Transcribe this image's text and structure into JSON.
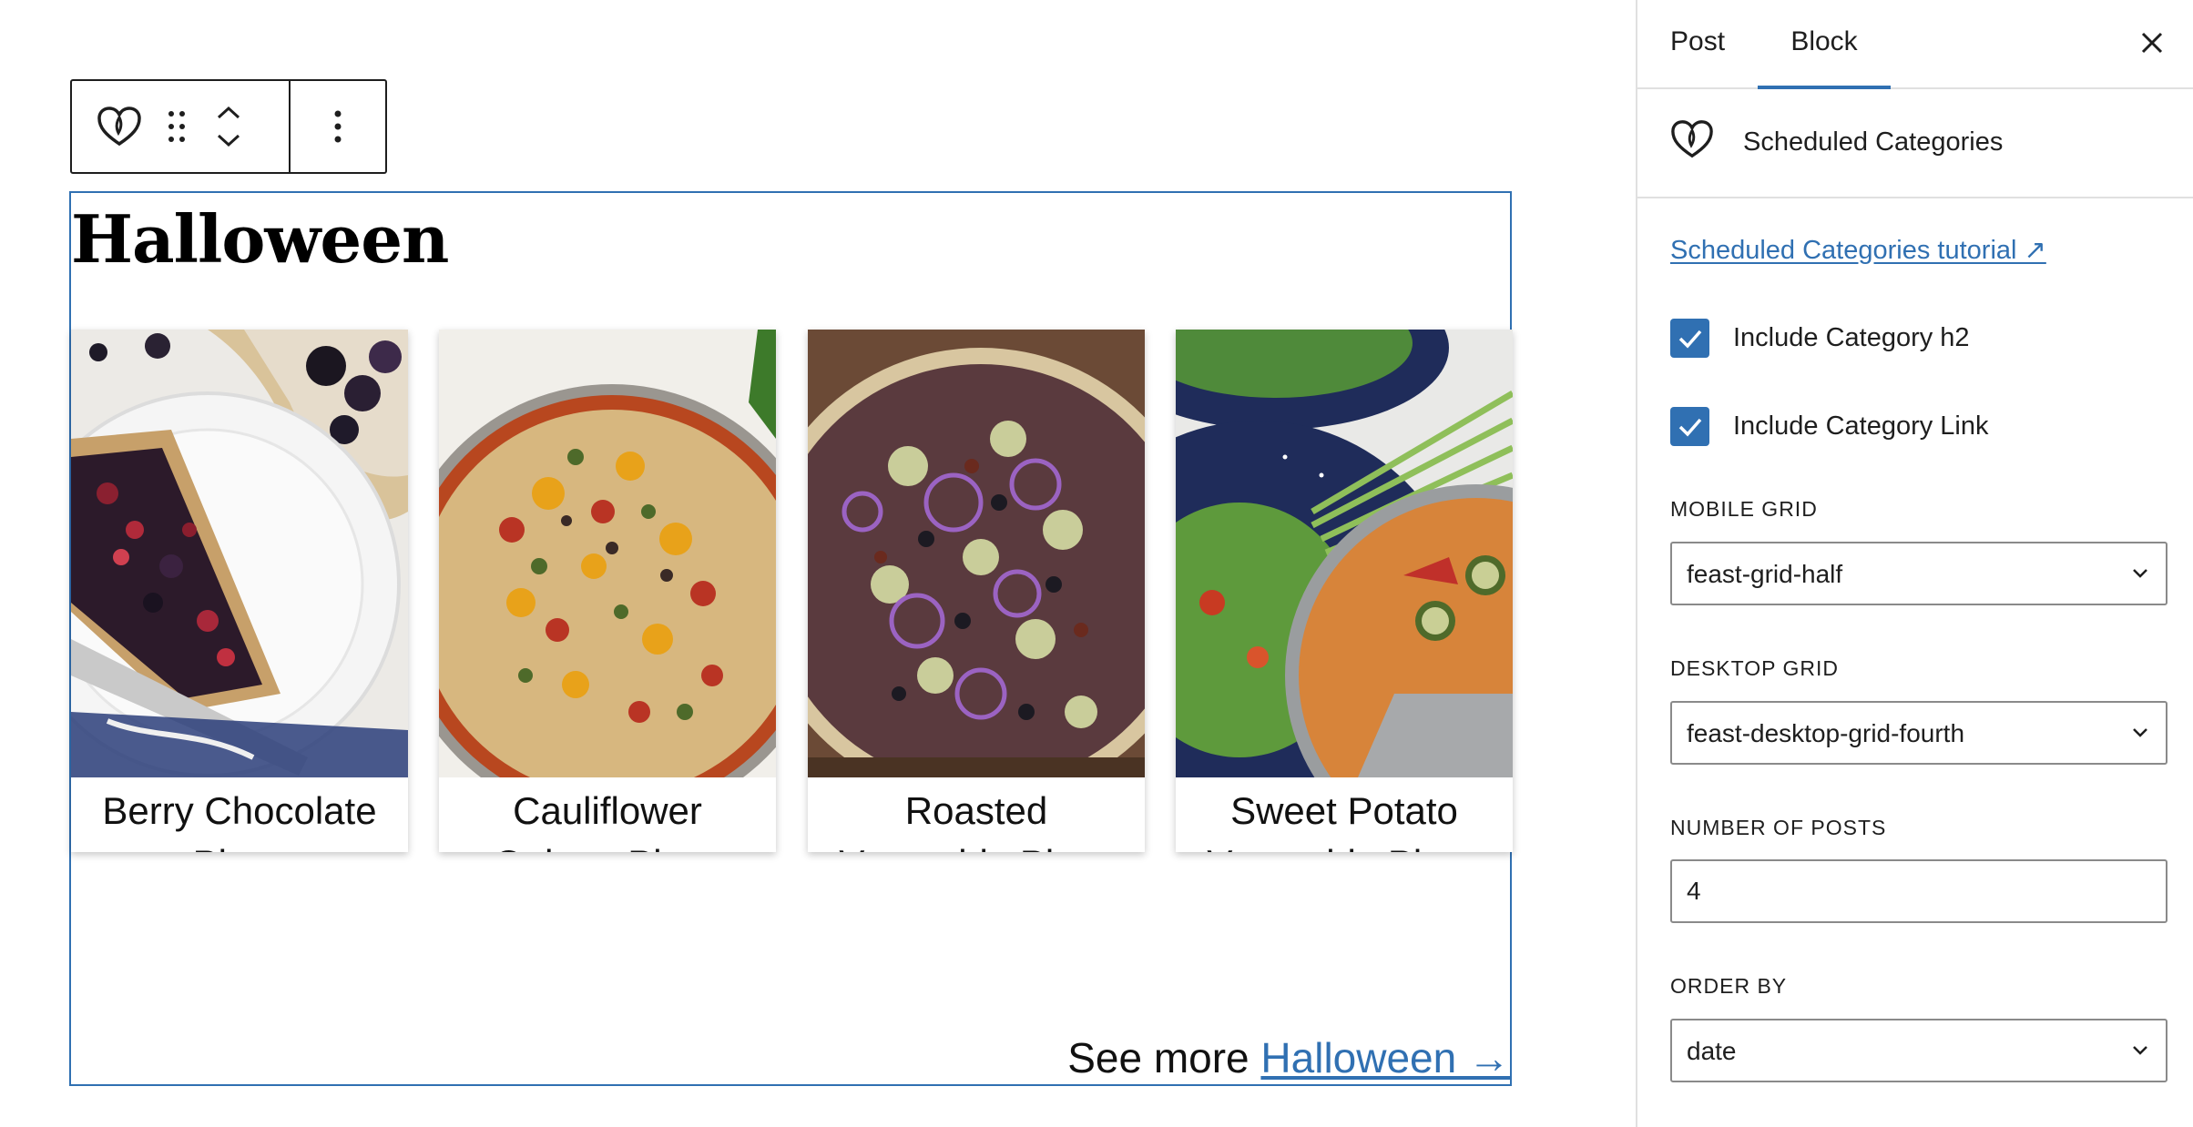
{
  "toolbar": {
    "block_icon": "heart-icon",
    "drag_icon": "drag-handle-icon",
    "move_up_icon": "chevron-up-icon",
    "move_down_icon": "chevron-down-icon",
    "options_icon": "more-vertical-icon"
  },
  "block": {
    "category_title": "Halloween",
    "posts": [
      {
        "title": "Berry Chocolate Pizza"
      },
      {
        "title": "Cauliflower Quinoa Pizza"
      },
      {
        "title": "Roasted Vegetable Pizza"
      },
      {
        "title": "Sweet Potato Vegetable Pizza Salad"
      }
    ],
    "see_more_prefix": "See more",
    "see_more_link": "Halloween →"
  },
  "sidebar": {
    "tabs": [
      {
        "label": "Post",
        "active": false
      },
      {
        "label": "Block",
        "active": true
      }
    ],
    "close_icon": "close-icon",
    "block_name": "Scheduled Categories",
    "block_icon": "heart-icon",
    "tutorial_link": "Scheduled Categories tutorial ↗",
    "include_h2": {
      "label": "Include Category h2",
      "checked": true
    },
    "include_link": {
      "label": "Include Category Link",
      "checked": true
    },
    "mobile_grid": {
      "label": "Mobile Grid",
      "value": "feast-grid-half"
    },
    "desktop_grid": {
      "label": "Desktop Grid",
      "value": "feast-desktop-grid-fourth"
    },
    "number_of_posts": {
      "label": "Number of Posts",
      "value": "4"
    },
    "order_by": {
      "label": "Order By",
      "value": "date"
    }
  },
  "colors": {
    "accent": "#3070b2",
    "text": "#1e1e1e",
    "border": "#e0e0e0"
  }
}
